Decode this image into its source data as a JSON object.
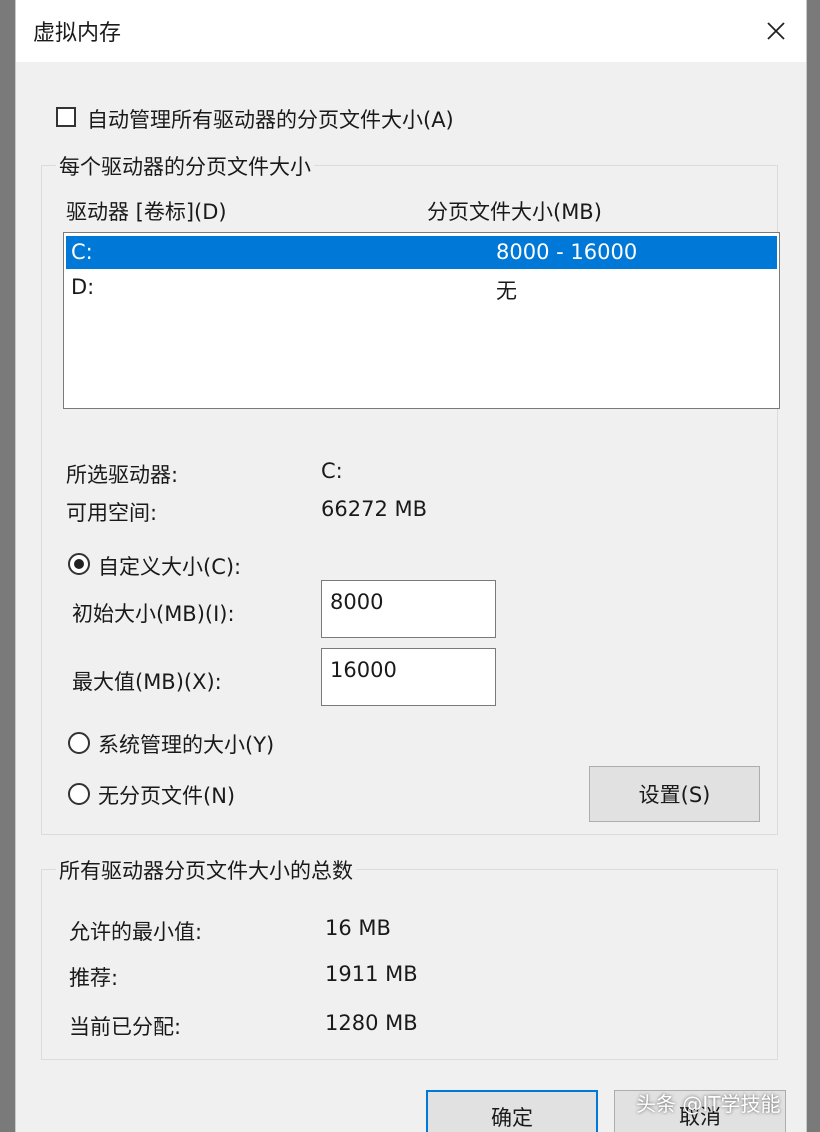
{
  "dialog": {
    "title": "虚拟内存",
    "auto_manage_label": "自动管理所有驱动器的分页文件大小(A)"
  },
  "per_drive": {
    "caption": "每个驱动器的分页文件大小",
    "col_drive": "驱动器 [卷标](D)",
    "col_size": "分页文件大小(MB)",
    "rows": [
      {
        "drive": "C:",
        "size": "8000 - 16000",
        "selected": true
      },
      {
        "drive": "D:",
        "size": "无",
        "selected": false
      }
    ],
    "selected_drive_label": "所选驱动器:",
    "selected_drive_value": "C:",
    "free_space_label": "可用空间:",
    "free_space_value": "66272 MB",
    "custom_size_label": "自定义大小(C):",
    "initial_size_label": "初始大小(MB)(I):",
    "initial_size_value": "8000",
    "max_size_label": "最大值(MB)(X):",
    "max_size_value": "16000",
    "system_managed_label": "系统管理的大小(Y)",
    "no_paging_label": "无分页文件(N)",
    "set_button": "设置(S)"
  },
  "totals": {
    "caption": "所有驱动器分页文件大小的总数",
    "min_label": "允许的最小值:",
    "min_value": "16 MB",
    "recommended_label": "推荐:",
    "recommended_value": "1911 MB",
    "allocated_label": "当前已分配:",
    "allocated_value": "1280 MB"
  },
  "buttons": {
    "ok": "确定",
    "cancel": "取消"
  },
  "watermark": "头条 @IT学技能",
  "colors": {
    "selection": "#0078d7",
    "dialog_bg": "#f0f0f0"
  }
}
